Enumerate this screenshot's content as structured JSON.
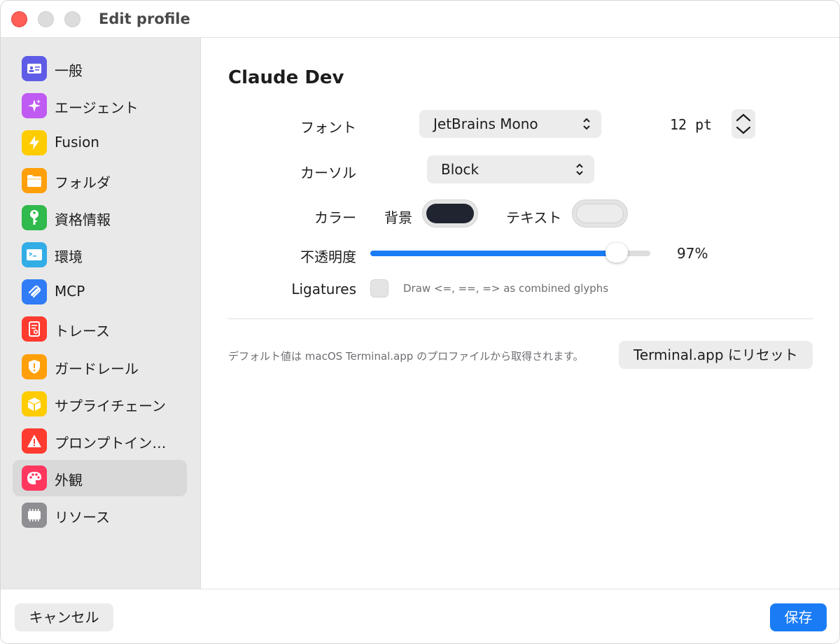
{
  "window": {
    "title": "Edit profile"
  },
  "sidebar": {
    "items": [
      {
        "label": "一般",
        "icon": "id-card-icon",
        "color": "#5e5ce6"
      },
      {
        "label": "エージェント",
        "icon": "sparkle-icon",
        "color": "#bf5af2"
      },
      {
        "label": "Fusion",
        "icon": "bolt-icon",
        "color": "#ffcc00"
      },
      {
        "label": "フォルダ",
        "icon": "folder-icon",
        "color": "#ff9f0a"
      },
      {
        "label": "資格情報",
        "icon": "key-icon",
        "color": "#30b94c"
      },
      {
        "label": "環境",
        "icon": "terminal-icon",
        "color": "#32ade6"
      },
      {
        "label": "MCP",
        "icon": "mcp-icon",
        "color": "#2f7cf6"
      },
      {
        "label": "トレース",
        "icon": "trace-icon",
        "color": "#ff3b30"
      },
      {
        "label": "ガードレール",
        "icon": "shield-icon",
        "color": "#ff9f0a"
      },
      {
        "label": "サプライチェーン",
        "icon": "box-icon",
        "color": "#ffcc00"
      },
      {
        "label": "プロンプトイン…",
        "icon": "warning-icon",
        "color": "#ff3b30"
      },
      {
        "label": "外観",
        "icon": "palette-icon",
        "color": "#ff375f"
      },
      {
        "label": "リソース",
        "icon": "chip-icon",
        "color": "#8e8e93"
      }
    ],
    "active_index": 11
  },
  "main": {
    "profile_name": "Claude Dev",
    "font": {
      "label": "フォント",
      "value": "JetBrains Mono",
      "size": "12 pt"
    },
    "cursor": {
      "label": "カーソル",
      "value": "Block"
    },
    "color": {
      "label": "カラー",
      "background_label": "背景",
      "background_color": "#1f2430",
      "text_label": "テキスト",
      "text_color": "#ececec"
    },
    "opacity": {
      "label": "不透明度",
      "value": 0.97,
      "display": "97%"
    },
    "ligatures": {
      "label": "Ligatures",
      "checked": false,
      "hint": "Draw <=, ==, => as combined glyphs"
    },
    "footnote": "デフォルト値は macOS Terminal.app のプロファイルから取得されます。",
    "reset_button": "Terminal.app にリセット"
  },
  "footer": {
    "cancel": "キャンセル",
    "save": "保存"
  },
  "colors": {
    "accent": "#1a7cf5",
    "close": "#ff5f57"
  }
}
